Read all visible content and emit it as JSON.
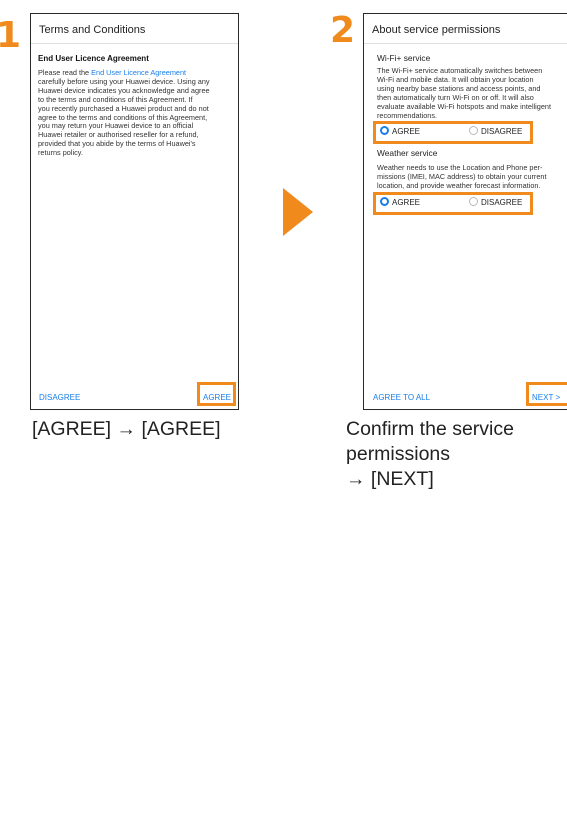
{
  "step1": {
    "number": "1",
    "screen_title": "Terms and Conditions",
    "heading": "End User Licence Agreement",
    "lines": [
      [
        "Please read the ",
        "End User Licence Agreement"
      ],
      "carefully before using your Huawei device. Using any",
      "Huawei device indicates you acknowledge and agree",
      "to the terms and conditions of this Agreement. If",
      "you recently purchased a Huawei product and do not",
      "agree to the terms and conditions of this Agreement,",
      "you may return your Huawei device to an official",
      "Huawei retailer or authorised reseller for a refund,",
      "provided that you abide by the terms of Huawei's",
      "returns policy."
    ],
    "text_intro": "Please read the ",
    "text_link": "End User Licence Agreement",
    "text_rest": [
      "carefully before using your Huawei device. Using any",
      "Huawei device indicates you acknowledge and agree",
      "to the terms and conditions of this Agreement. If",
      "you recently purchased a Huawei product and do not",
      "agree to the terms and conditions of this Agreement,",
      "you may return your Huawei device to an official",
      "Huawei retailer or authorised reseller for a refund,",
      "provided that you abide by the terms of Huawei's",
      "returns policy."
    ],
    "disagree_label": "DISAGREE",
    "agree_label": "AGREE",
    "caption": "[AGREE] → [AGREE]"
  },
  "step2": {
    "number": "2",
    "screen_title": "About service permissions",
    "wifi": {
      "title": "Wi-Fi+ service",
      "lines": [
        "The Wi-Fi+ service automatically switches between",
        "Wi-Fi and mobile data. It will obtain your location",
        "using nearby base stations and access points, and",
        "then automatically turn Wi-Fi on or off. It will also",
        "evaluate available Wi-Fi hotspots and make intelligent",
        "recommendations."
      ],
      "agree": "AGREE",
      "disagree": "DISAGREE"
    },
    "weather": {
      "title": "Weather service",
      "lines": [
        "Weather needs to use the Location and Phone per-",
        "missions (IMEI, MAC address) to obtain your current",
        "location, and provide weather forecast information."
      ],
      "agree": "AGREE",
      "disagree": "DISAGREE"
    },
    "agree_all_label": "AGREE TO ALL",
    "next_label": "NEXT",
    "next_chevron": ">",
    "caption_lines": [
      "Confirm the service",
      "permissions",
      "→ [NEXT]"
    ]
  },
  "colors": {
    "accent": "#f08a1c",
    "link": "#1a7ee8"
  }
}
